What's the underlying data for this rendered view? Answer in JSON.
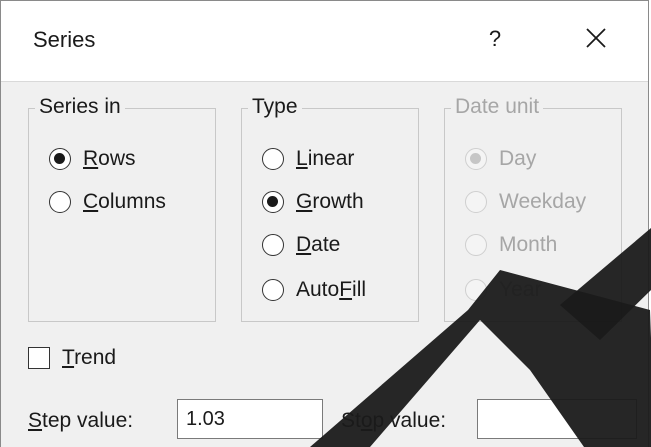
{
  "dialog": {
    "title": "Series",
    "help_label": "?"
  },
  "series_in": {
    "legend": "Series in",
    "options": [
      {
        "pre": "",
        "key": "R",
        "post": "ows",
        "selected": true
      },
      {
        "pre": "",
        "key": "C",
        "post": "olumns",
        "selected": false
      }
    ]
  },
  "type": {
    "legend": "Type",
    "options": [
      {
        "pre": "",
        "key": "L",
        "post": "inear",
        "selected": false
      },
      {
        "pre": "",
        "key": "G",
        "post": "rowth",
        "selected": true
      },
      {
        "pre": "",
        "key": "D",
        "post": "ate",
        "selected": false
      },
      {
        "pre": "Auto",
        "key": "F",
        "post": "ill",
        "selected": false
      }
    ]
  },
  "date_unit": {
    "legend": "Date unit",
    "enabled": false,
    "options": [
      {
        "label": "Day",
        "selected": true
      },
      {
        "label": "Weekday",
        "selected": false
      },
      {
        "label": "Month",
        "selected": false
      },
      {
        "label": "Year",
        "selected": false
      }
    ]
  },
  "trend": {
    "key": "T",
    "post": "rend",
    "checked": false
  },
  "step": {
    "key": "S",
    "post": "tep value:",
    "value": "1.03"
  },
  "stop": {
    "pre": "St",
    "key": "o",
    "post": "p value:",
    "value": ""
  },
  "colors": {
    "dialog_bg": "#f0f0f0",
    "titlebar_bg": "#ffffff",
    "disabled_text": "#a6a6a6",
    "watermark": "#1a1a1a"
  }
}
